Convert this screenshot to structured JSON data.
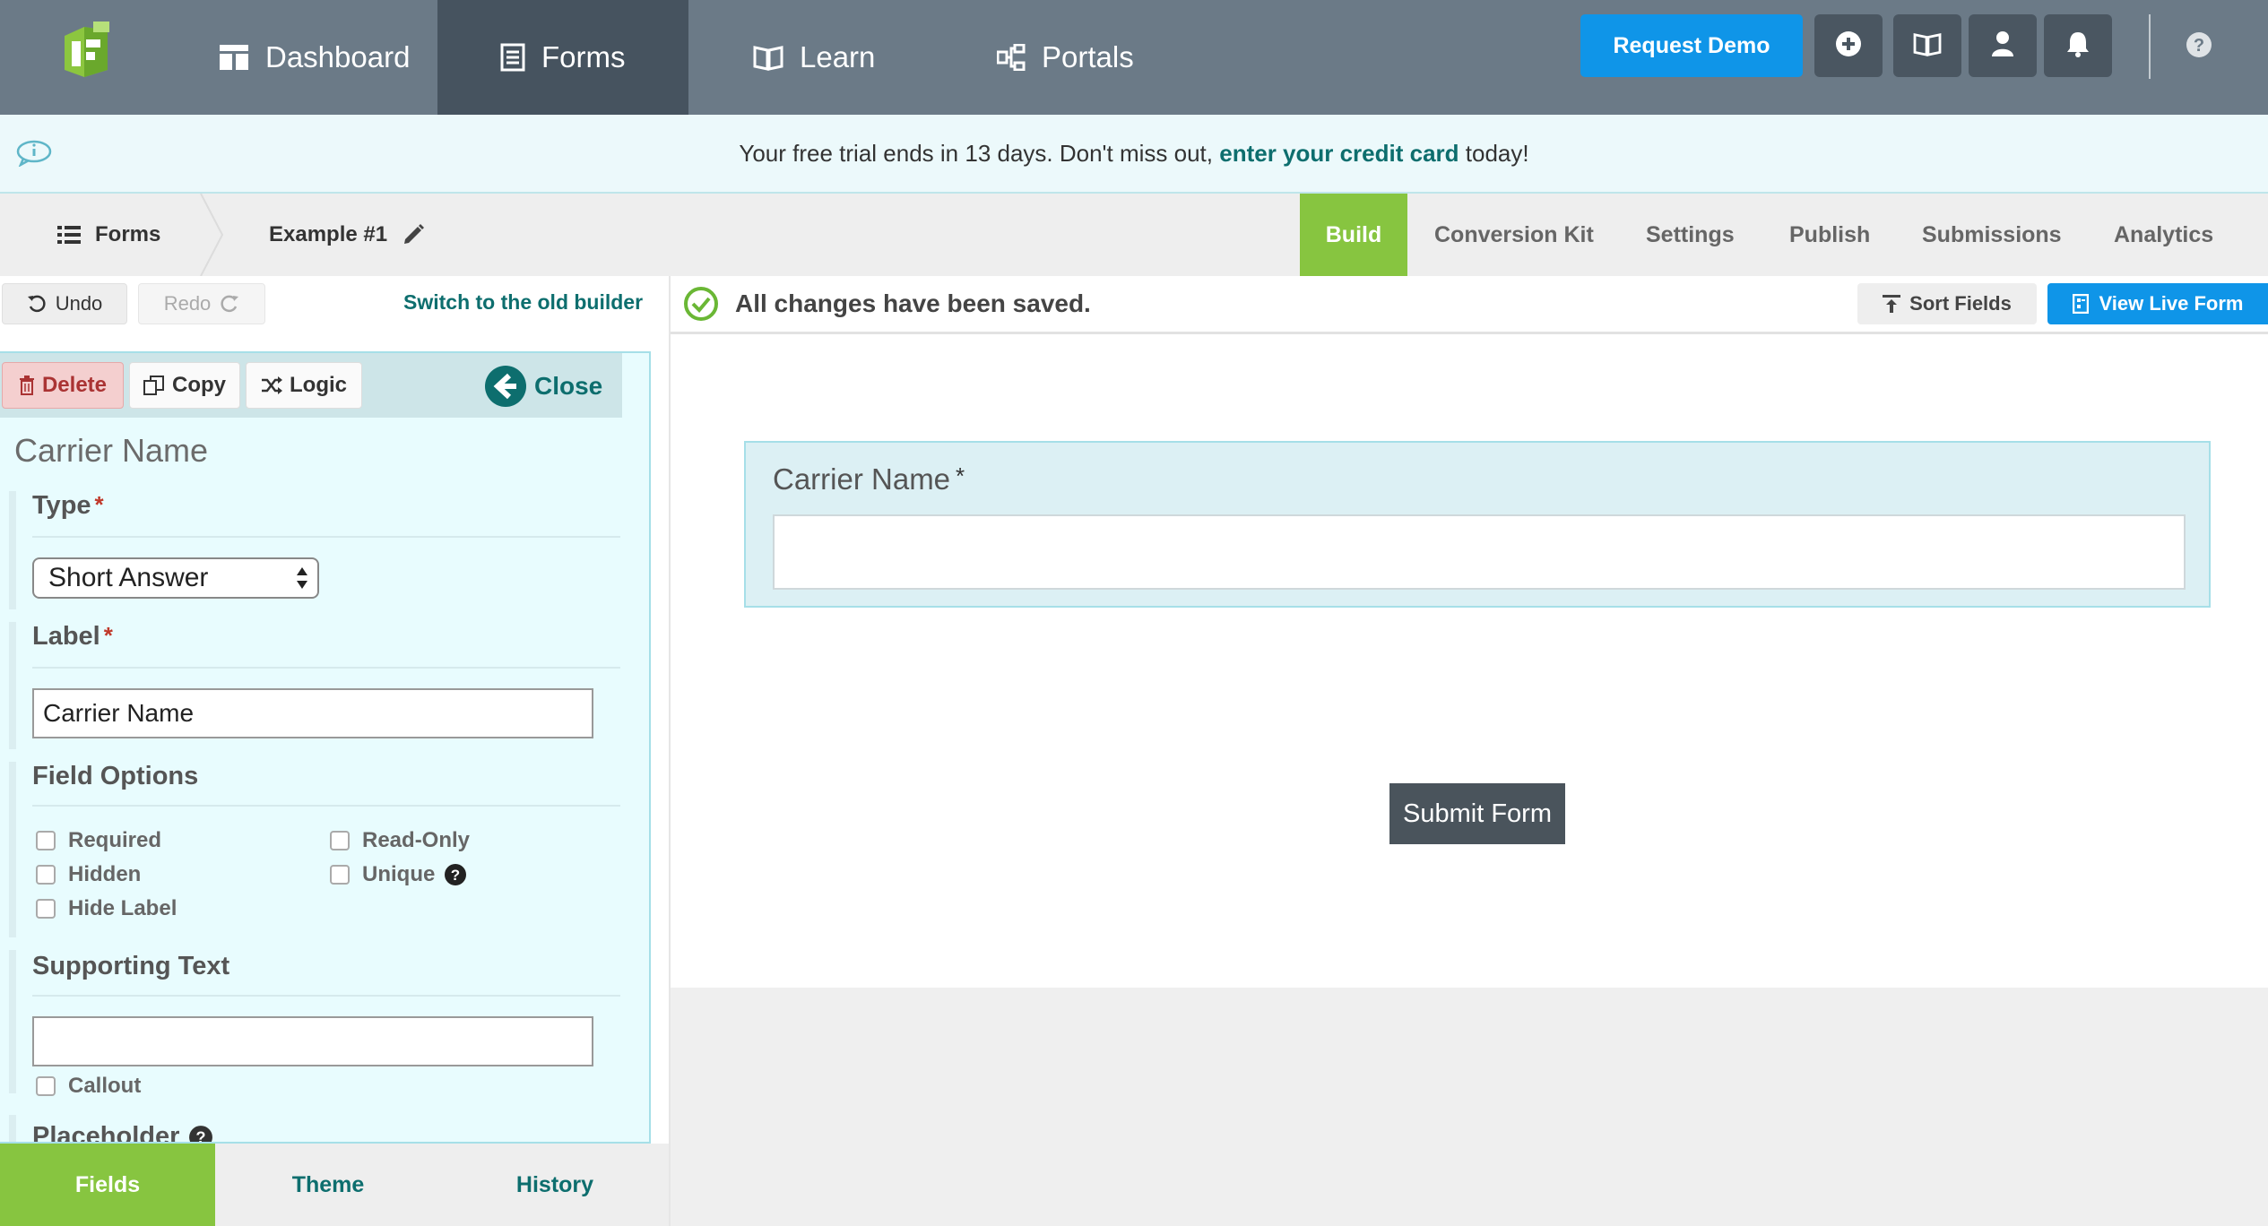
{
  "nav": {
    "items": [
      {
        "label": "Dashboard",
        "icon": "dashboard-icon"
      },
      {
        "label": "Forms",
        "icon": "forms-icon"
      },
      {
        "label": "Learn",
        "icon": "book-icon"
      },
      {
        "label": "Portals",
        "icon": "portals-icon"
      }
    ],
    "request_demo": "Request Demo",
    "icons": [
      "plus-circle-icon",
      "book-icon",
      "user-icon",
      "bell-icon",
      "help-icon"
    ]
  },
  "banner": {
    "text_before": "Your free trial ends in 13 days. Don't miss out, ",
    "link": "enter your credit card",
    "text_after": " today!"
  },
  "breadcrumb": {
    "forms": "Forms",
    "form_name": "Example #1"
  },
  "tabs": [
    "Build",
    "Conversion Kit",
    "Settings",
    "Publish",
    "Submissions",
    "Analytics"
  ],
  "toolbar": {
    "undo": "Undo",
    "redo": "Redo",
    "switch_builder": "Switch to the old builder",
    "save_status": "All changes have been saved.",
    "sort_fields": "Sort Fields",
    "view_live_form": "View Live Form"
  },
  "field_editor": {
    "delete": "Delete",
    "copy": "Copy",
    "logic": "Logic",
    "close": "Close",
    "title": "Carrier Name",
    "type_label": "Type",
    "type_value": "Short Answer",
    "label_label": "Label",
    "label_value": "Carrier Name",
    "field_options_label": "Field Options",
    "options": {
      "required": "Required",
      "read_only": "Read-Only",
      "hidden": "Hidden",
      "unique": "Unique",
      "hide_label": "Hide Label"
    },
    "supporting_text_label": "Supporting Text",
    "supporting_text_value": "",
    "callout": "Callout",
    "placeholder_label": "Placeholder"
  },
  "bottom_tabs": [
    "Fields",
    "Theme",
    "History"
  ],
  "canvas": {
    "field_label": "Carrier Name",
    "required_mark": "*",
    "submit": "Submit Form"
  },
  "colors": {
    "nav_bg": "#6b7a87",
    "nav_active": "#46535f",
    "accent_blue": "#0f95e8",
    "accent_green": "#87c540",
    "teal_link": "#0d6e6e"
  }
}
